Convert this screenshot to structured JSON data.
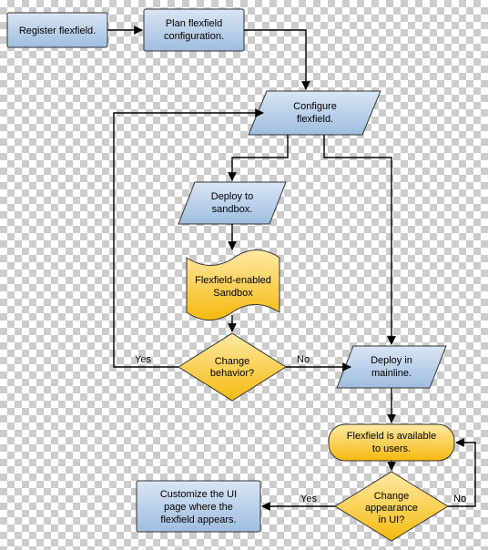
{
  "nodes": {
    "register": {
      "type": "process",
      "label": "Register flexfield."
    },
    "plan": {
      "type": "process",
      "label": "Plan flexfield configuration."
    },
    "configure": {
      "type": "io",
      "label": "Configure flexfield."
    },
    "deploy_sb": {
      "type": "io",
      "label": "Deploy to sandbox."
    },
    "sandbox": {
      "type": "doc",
      "label": "Flexfield-enabled Sandbox"
    },
    "change_beh": {
      "type": "decision",
      "label": "Change behavior?"
    },
    "deploy_ml": {
      "type": "io",
      "label": "Deploy in mainline."
    },
    "available": {
      "type": "terminator",
      "label": "Flexfield is available to users."
    },
    "change_ui": {
      "type": "decision",
      "label": "Change appearance in UI?"
    },
    "customize": {
      "type": "process",
      "label": "Customize the UI page where the flexfield appears."
    }
  },
  "edges": [
    {
      "from": "register",
      "to": "plan"
    },
    {
      "from": "plan",
      "to": "configure"
    },
    {
      "from": "configure",
      "to": "deploy_sb"
    },
    {
      "from": "deploy_sb",
      "to": "sandbox"
    },
    {
      "from": "sandbox",
      "to": "change_beh"
    },
    {
      "from": "change_beh",
      "to": "configure",
      "label": "Yes"
    },
    {
      "from": "change_beh",
      "to": "deploy_ml",
      "label": "No"
    },
    {
      "from": "configure",
      "to": "deploy_ml"
    },
    {
      "from": "deploy_ml",
      "to": "available"
    },
    {
      "from": "available",
      "to": "change_ui"
    },
    {
      "from": "change_ui",
      "to": "customize",
      "label": "Yes"
    },
    {
      "from": "change_ui",
      "to": "available",
      "label": "No"
    }
  ],
  "edge_labels": {
    "yes": "Yes",
    "no": "No"
  },
  "colors": {
    "blue_top": "#cfe0f2",
    "blue_bot": "#a0bfe0",
    "gold_top": "#fde9a7",
    "gold_bot": "#f5b90f",
    "stroke": "#333"
  }
}
